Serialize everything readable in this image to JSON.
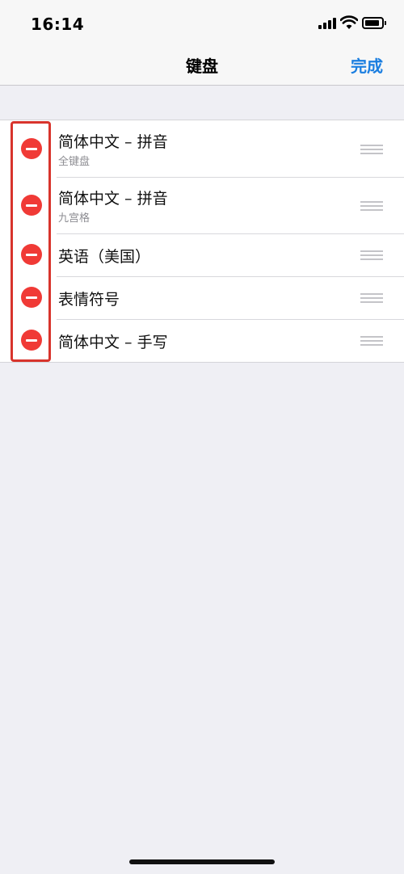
{
  "status_bar": {
    "time": "16:14",
    "icons": [
      "cellular-signal-icon",
      "wifi-icon",
      "battery-icon"
    ]
  },
  "nav": {
    "title": "键盘",
    "done_label": "完成",
    "accent_color": "#1a7ee0"
  },
  "keyboards": [
    {
      "label": "简体中文 – 拼音",
      "sublabel": "全键盘"
    },
    {
      "label": "简体中文 – 拼音",
      "sublabel": "九宫格"
    },
    {
      "label": "英语（美国）"
    },
    {
      "label": "表情符号"
    },
    {
      "label": "简体中文 – 手写"
    }
  ],
  "colors": {
    "delete_button": "#f03a36",
    "highlight_annotation": "#d8342c"
  }
}
